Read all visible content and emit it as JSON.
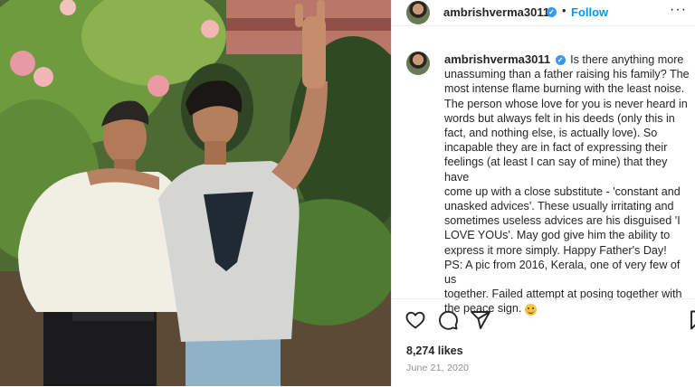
{
  "post": {
    "author": "ambrishverma3011",
    "follow_label": "Follow",
    "separator": "•",
    "more_label": "···",
    "caption_lines": [
      "Is there anything more",
      "unassuming than a father raising his family? The",
      "most intense flame burning with the least noise.",
      "The person whose love for you is never heard in",
      "words but always felt in his deeds (only this in",
      "fact, and nothing else, is actually love). So",
      "incapable they are in fact of expressing their",
      "feelings (at least I can say of mine) that they have",
      "come up with a close substitute - 'constant and",
      "unasked advices'. These usually irritating and",
      "sometimes useless advices are his disguised 'I",
      "LOVE YOUs'. May god give him the ability to",
      "express it more simply. Happy Father's Day!",
      "PS: A pic from 2016, Kerala, one of very few of us",
      "together. Failed attempt at posing together with",
      "the peace sign."
    ],
    "likes": "8,274 likes",
    "date": "June 21, 2020"
  },
  "colors": {
    "accent": "#0095f6",
    "verified": "#3897f0",
    "text": "#262626",
    "muted": "#8e8e8e"
  },
  "icons": {
    "verified": "verified-badge-icon",
    "like": "heart-icon",
    "comment": "comment-icon",
    "share": "paper-plane-icon",
    "save": "bookmark-icon",
    "emoji": "smiling-face-emoji"
  }
}
